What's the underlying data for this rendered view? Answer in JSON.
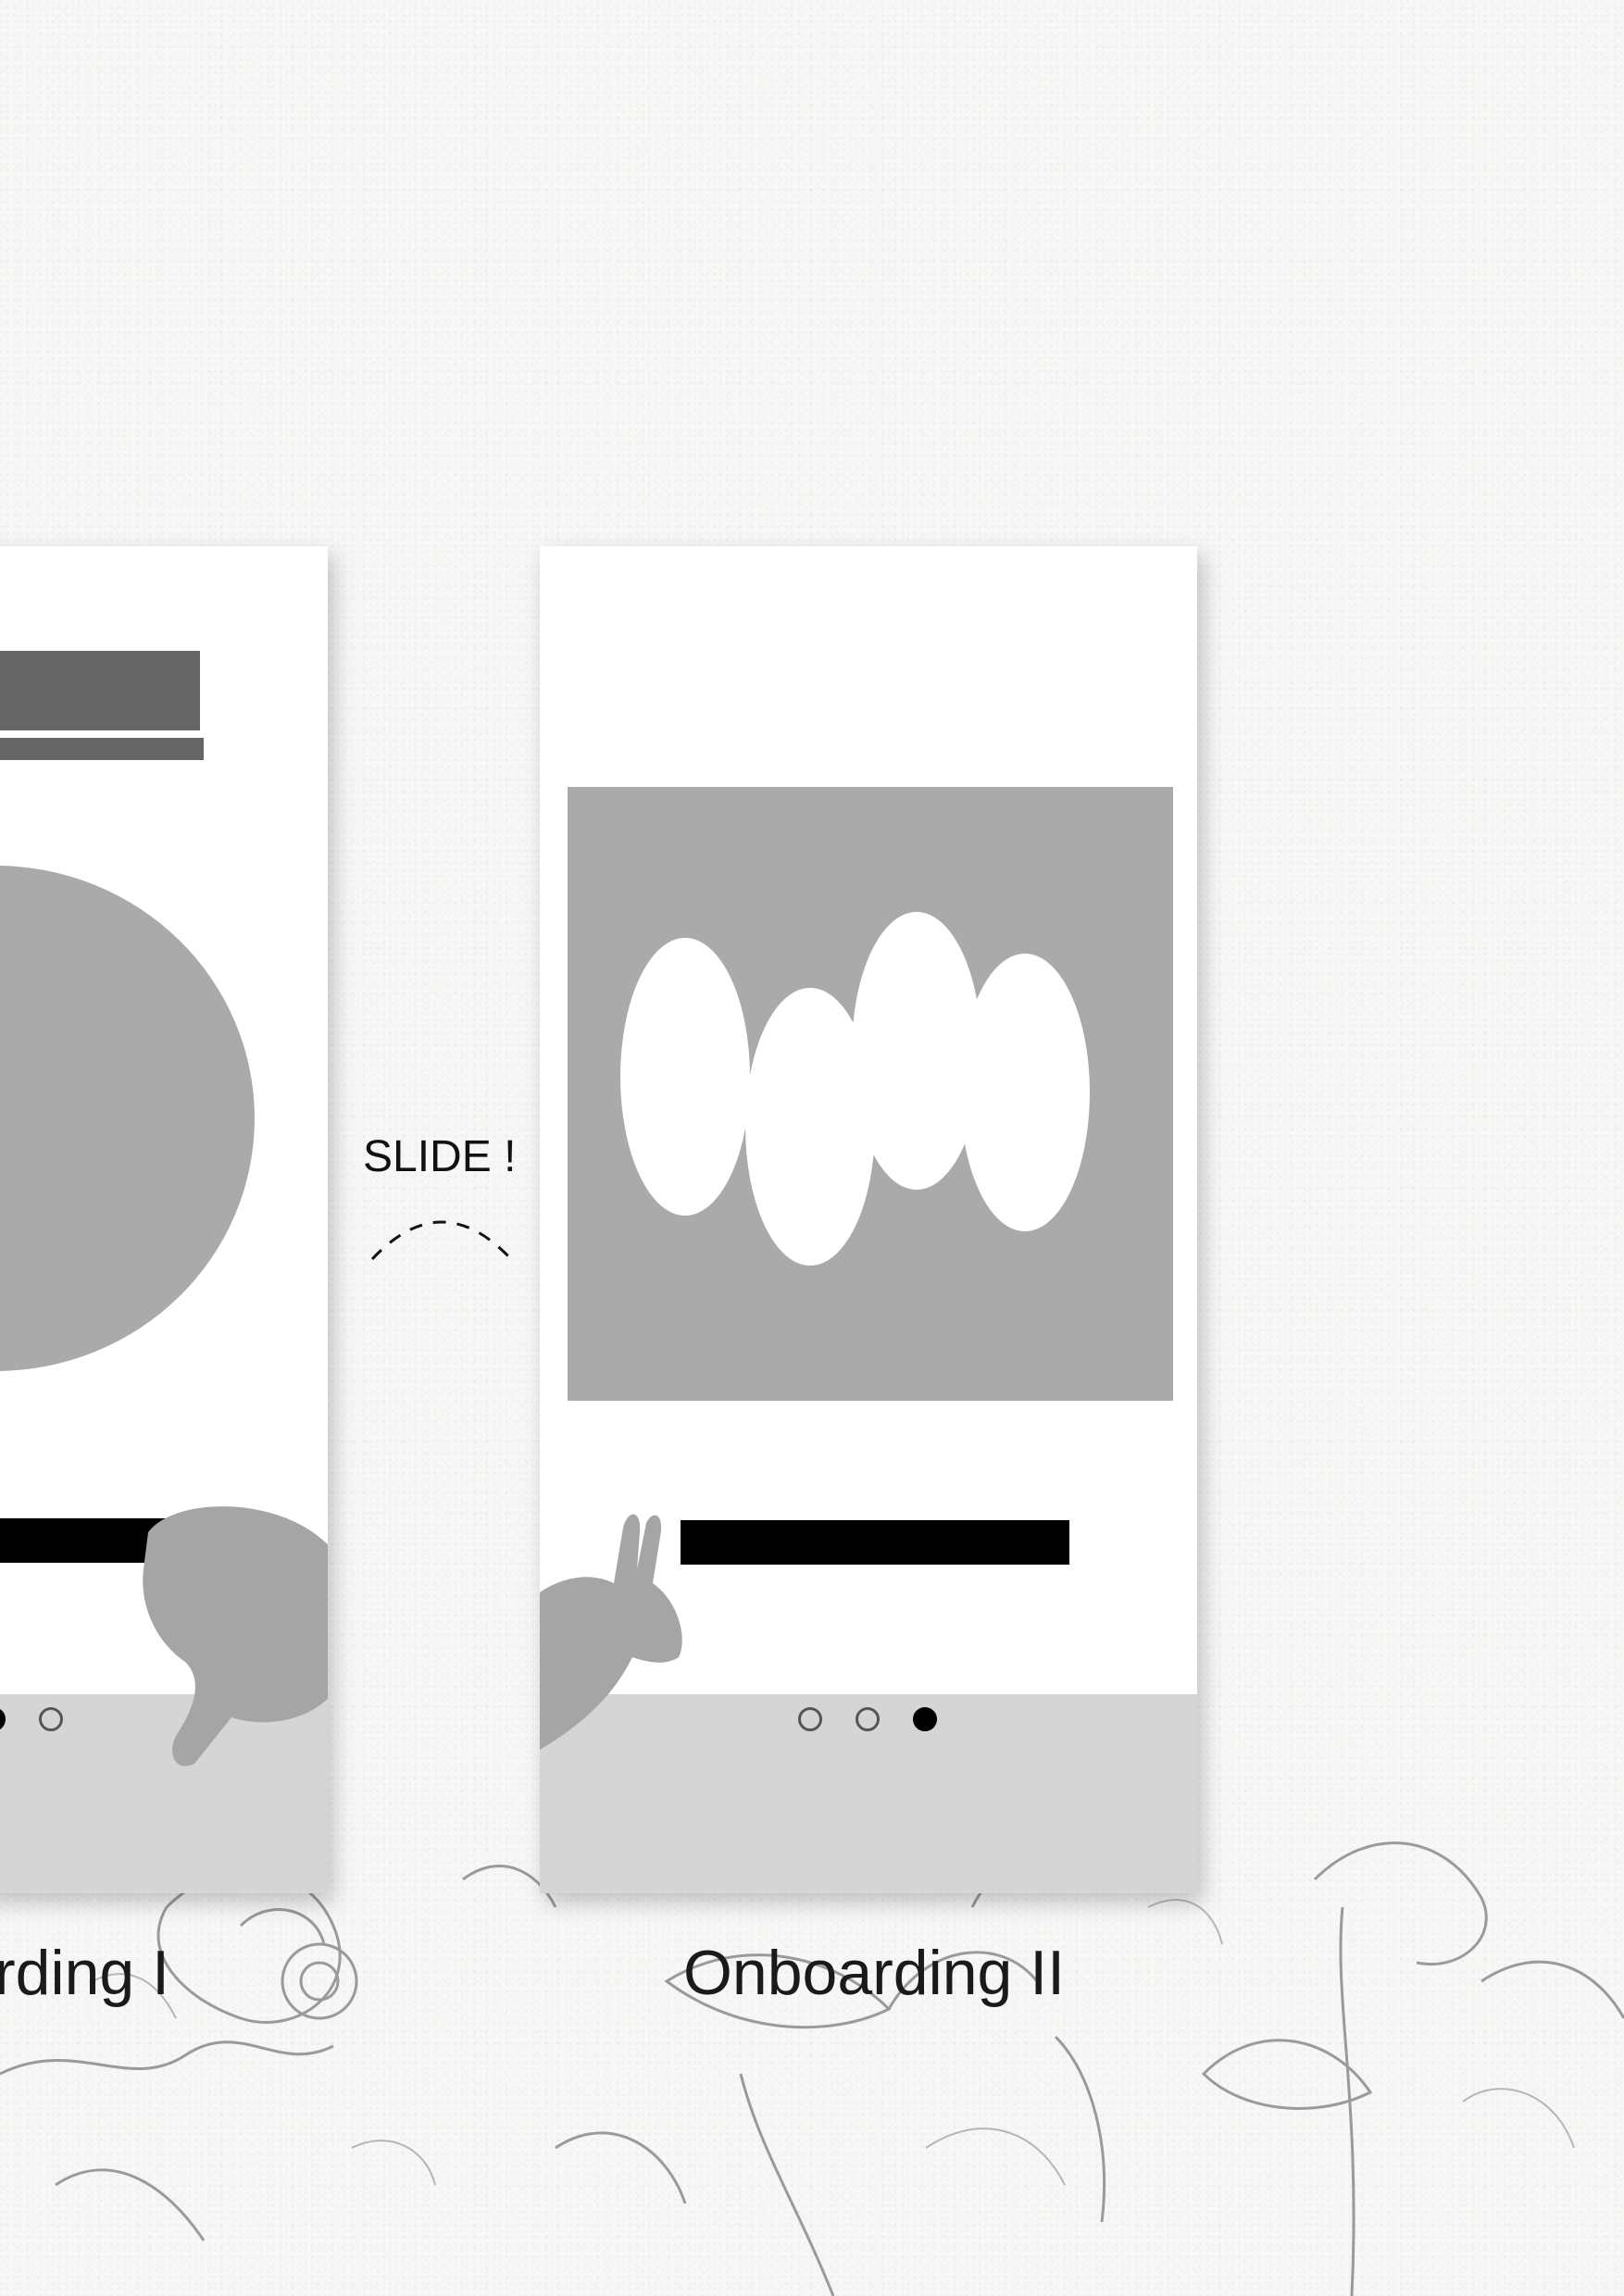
{
  "screens": [
    {
      "caption": "rding I",
      "page_dots": {
        "count": 3,
        "active_index": 1
      }
    },
    {
      "caption": "Onboarding II",
      "page_dots": {
        "count": 3,
        "active_index": 2
      }
    }
  ],
  "gesture_hint": {
    "label": "SLIDE !"
  },
  "colors": {
    "placeholder_gray": "#aaaaaa",
    "dark_bar": "#666666",
    "footer_gray": "#d5d5d5",
    "text_black": "#000000"
  },
  "icons": [
    "rabbit-icon",
    "swipe-arc-icon",
    "botanical-illustration"
  ]
}
